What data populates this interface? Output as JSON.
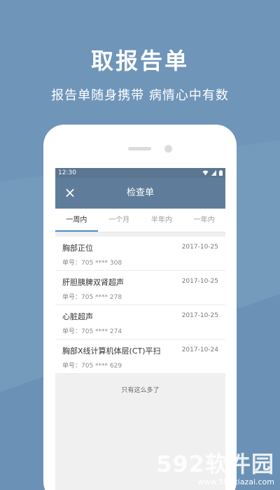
{
  "promo": {
    "title": "取报告单",
    "subtitle": "报告单随身携带 病情心中有数"
  },
  "statusbar": {
    "time": "12:30",
    "icons": [
      "wifi-icon",
      "signal-icon",
      "battery-icon"
    ]
  },
  "appbar": {
    "close_icon": "×",
    "title": "检查单"
  },
  "tabs": [
    {
      "label": "一周内",
      "active": true
    },
    {
      "label": "一个月",
      "active": false
    },
    {
      "label": "半年内",
      "active": false
    },
    {
      "label": "一年内",
      "active": false
    }
  ],
  "records": [
    {
      "title": "胸部正位",
      "date": "2017-10-25",
      "number": "单号：705 **** 308"
    },
    {
      "title": "肝胆胰脾双肾超声",
      "date": "2017-10-25",
      "number": "单号：705 **** 278"
    },
    {
      "title": "心脏超声",
      "date": "2017-10-25",
      "number": "单号：705 **** 274"
    },
    {
      "title": "胸部X线计算机体层(CT)平扫",
      "date": "2017-10-24",
      "number": "单号：705 **** 629"
    }
  ],
  "footer_note": "只有这么多了",
  "watermark": {
    "logo": "592软件园",
    "url": "www.592xiazai.com"
  },
  "colors": {
    "background": "#6f95b9",
    "appbar": "#5f7d9a",
    "tab_indicator": "#4a90c6"
  }
}
